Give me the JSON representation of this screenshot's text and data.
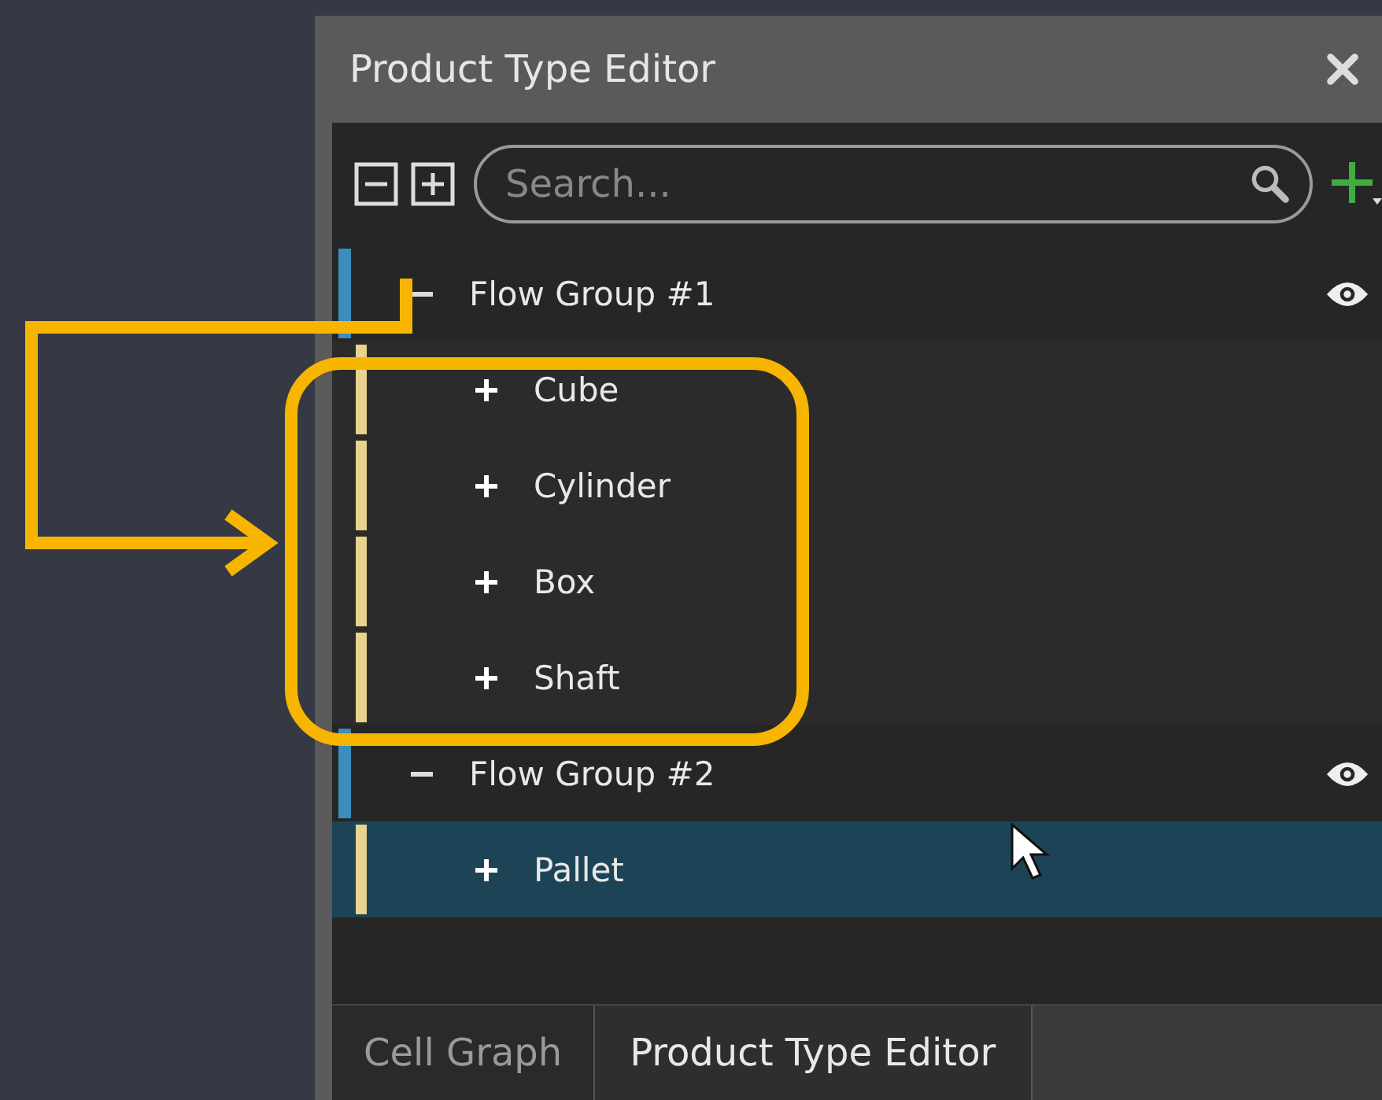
{
  "window": {
    "title": "Product Type Editor"
  },
  "toolbar": {
    "search": {
      "placeholder": "Search..."
    }
  },
  "tree": [
    {
      "kind": "group",
      "label": "Flow Group #1",
      "expanded": true,
      "selected": false,
      "visible": true,
      "children": [
        {
          "kind": "product",
          "label": "Cube",
          "expanded": false,
          "selected": false
        },
        {
          "kind": "product",
          "label": "Cylinder",
          "expanded": false,
          "selected": false
        },
        {
          "kind": "product",
          "label": "Box",
          "expanded": false,
          "selected": false
        },
        {
          "kind": "product",
          "label": "Shaft",
          "expanded": false,
          "selected": false
        }
      ]
    },
    {
      "kind": "group",
      "label": "Flow Group #2",
      "expanded": true,
      "selected": false,
      "visible": true,
      "children": [
        {
          "kind": "product",
          "label": "Pallet",
          "expanded": false,
          "selected": true
        }
      ]
    }
  ],
  "tabs": [
    {
      "label": "Cell Graph",
      "selected": false
    },
    {
      "label": "Product Type Editor",
      "selected": true
    }
  ]
}
